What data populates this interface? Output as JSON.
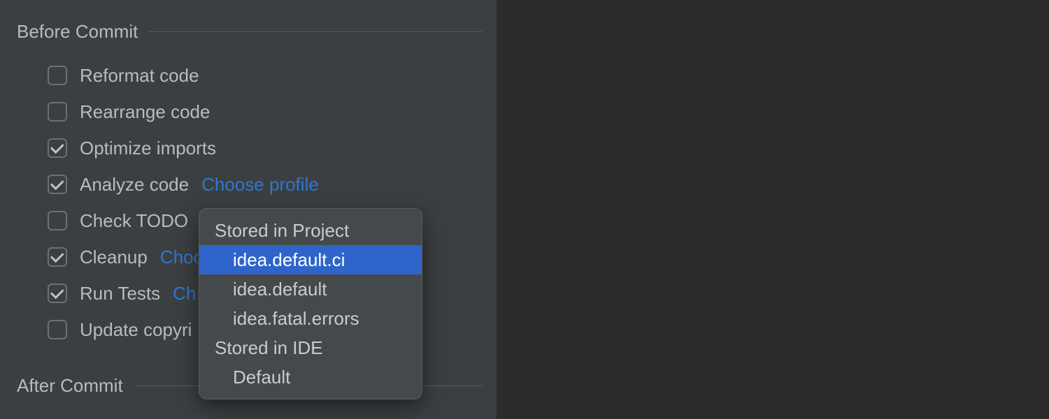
{
  "sections": {
    "before_commit": "Before Commit",
    "after_commit": "After Commit"
  },
  "options": {
    "reformat_code": {
      "label": "Reformat code",
      "checked": false
    },
    "rearrange_code": {
      "label": "Rearrange code",
      "checked": false
    },
    "optimize_imports": {
      "label": "Optimize imports",
      "checked": true
    },
    "analyze_code": {
      "label": "Analyze code",
      "checked": true,
      "link": "Choose profile"
    },
    "check_todo": {
      "label": "Check TODO",
      "checked": false
    },
    "cleanup": {
      "label": "Cleanup",
      "checked": true,
      "link": "Choo"
    },
    "run_tests": {
      "label": "Run Tests",
      "checked": true,
      "link": "Ch"
    },
    "update_copyright": {
      "label": "Update copyri",
      "checked": false
    }
  },
  "popup": {
    "group1_header": "Stored in Project",
    "item1": "idea.default.ci",
    "item2": "idea.default",
    "item3": "idea.fatal.errors",
    "group2_header": "Stored in IDE",
    "item4": "Default"
  }
}
